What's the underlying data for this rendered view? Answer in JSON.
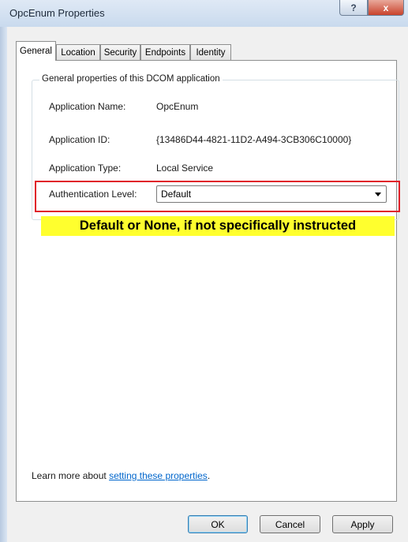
{
  "window": {
    "title": "OpcEnum Properties",
    "help_glyph": "?",
    "close_glyph": "x"
  },
  "tabs": [
    {
      "label": "General",
      "active": true
    },
    {
      "label": "Location",
      "active": false
    },
    {
      "label": "Security",
      "active": false
    },
    {
      "label": "Endpoints",
      "active": false
    },
    {
      "label": "Identity",
      "active": false
    }
  ],
  "group": {
    "legend": "General properties of this DCOM application"
  },
  "properties": {
    "app_name_label": "Application Name:",
    "app_name_value": "OpcEnum",
    "app_id_label": "Application ID:",
    "app_id_value": "{13486D44-4821-11D2-A494-3CB306C10000}",
    "app_type_label": "Application Type:",
    "app_type_value": "Local Service",
    "auth_label": "Authentication Level:",
    "auth_value": "Default"
  },
  "annotation": {
    "note": "Default or None, if not specifically instructed",
    "highlight_color": "#e0222a",
    "note_bg": "#ffff2e"
  },
  "footer": {
    "learn_prefix": "Learn more about ",
    "learn_link": "setting these properties",
    "learn_suffix": "."
  },
  "buttons": {
    "ok": "OK",
    "cancel": "Cancel",
    "apply": "Apply"
  }
}
